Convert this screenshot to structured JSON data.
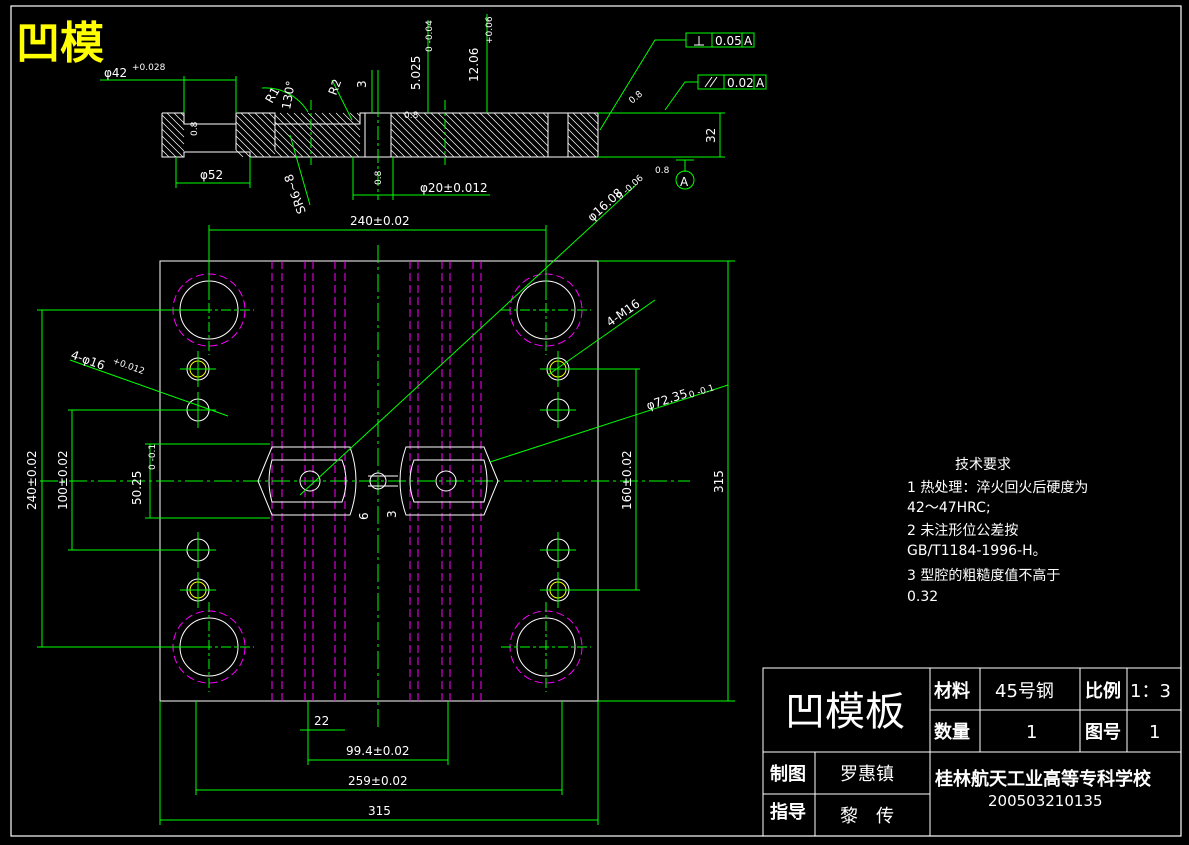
{
  "drawing_title": "凹模",
  "technical_requirements": {
    "heading": "技术要求",
    "lines": [
      "1 热处理：淬火回火后硬度为",
      "42～47HRC;",
      "2 未注形位公差按",
      "GB/T1184-1996-H。",
      "3 型腔的粗糙度值不高于",
      "0.32"
    ]
  },
  "title_block": {
    "part_name": "凹模板",
    "material_label": "材料",
    "material_value": "45号钢",
    "scale_label": "比例",
    "scale_value": "1：3",
    "quantity_label": "数量",
    "quantity_value": "1",
    "drawing_no_label": "图号",
    "drawing_no_value": "1",
    "drawn_by_label": "制图",
    "drawn_by_value": "罗惠镇",
    "advisor_label": "指导",
    "advisor_value": "黎　传",
    "school": "桂林航天工业高等专科学校",
    "student_id": "200503210135"
  },
  "tolerance_frames": {
    "perpendicularity_value": "0.05",
    "parallelism_value": "0.02",
    "datum": "A",
    "datum_label": "A"
  },
  "section_dims": {
    "d42": "φ42",
    "d42_tol": "+0.028",
    "d52": "φ52",
    "d20": "φ20±0.012",
    "r1": "R1",
    "r2": "R2",
    "ang130": "130°",
    "dim3": "3",
    "dim5025": "5.025",
    "dim5025_tol": "0\n-0.04",
    "dim1206": "12.06",
    "dim1206_tol": "+0.06",
    "dim32": "32",
    "sr": "SR6~8",
    "rough08": "0.8",
    "rough08b": "0.8",
    "rough08c": "0.8",
    "rough08d": "0.8",
    "rough08e": "0.8"
  },
  "plan_dims": {
    "d240_top": "240±0.02",
    "d1608": "φ16.08",
    "d1608_tol": "0\n-0.06",
    "m16": "4-M16",
    "d16x4": "4-φ16",
    "d16x4_tol": "+0.012",
    "d7235": "φ72.35",
    "d7235_tol": "0\n-0.1",
    "d240_left": "240±0.02",
    "d100": "100±0.02",
    "d5025": "50.25",
    "d5025_tol": "0\n-0.1",
    "d160": "160±0.02",
    "d315_right": "315",
    "d6": "6",
    "d3": "3",
    "d22": "22",
    "d994": "99.4±0.02",
    "d259": "259±0.02",
    "d315_bottom": "315"
  },
  "colors": {
    "outline": "#ffffff",
    "dimension": "#00ff00",
    "hidden_line": "#ff00ff",
    "center_line": "#00ff00",
    "hatch": "#ffffff",
    "title": "#ffff00",
    "border": "#ffffff"
  }
}
